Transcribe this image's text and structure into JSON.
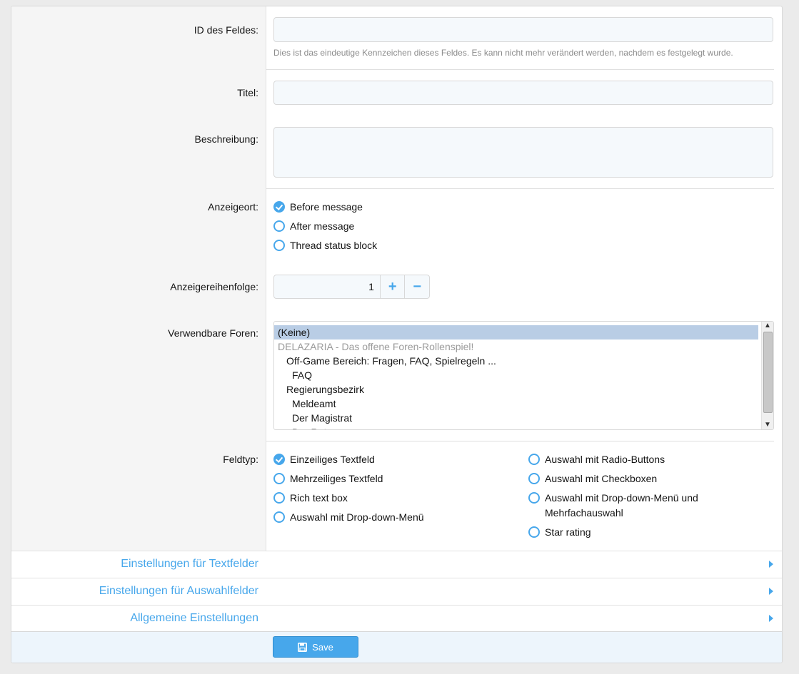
{
  "fields": {
    "field_id": {
      "label": "ID des Feldes:",
      "value": "",
      "hint": "Dies ist das eindeutige Kennzeichen dieses Feldes. Es kann nicht mehr verändert werden, nachdem es festgelegt wurde."
    },
    "title": {
      "label": "Titel:",
      "value": ""
    },
    "description": {
      "label": "Beschreibung:",
      "value": ""
    }
  },
  "display_location": {
    "label": "Anzeigeort:",
    "options": [
      {
        "label": "Before message",
        "checked": true
      },
      {
        "label": "After message",
        "checked": false
      },
      {
        "label": "Thread status block",
        "checked": false
      }
    ]
  },
  "display_order": {
    "label": "Anzeigereihenfolge:",
    "value": "1",
    "plus": "+",
    "minus": "−"
  },
  "forums": {
    "label": "Verwendbare Foren:",
    "options": [
      {
        "label": "(Keine)",
        "selected": true,
        "disabled": false,
        "depth": 0
      },
      {
        "label": "DELAZARIA - Das offene Foren-Rollenspiel!",
        "selected": false,
        "disabled": true,
        "depth": 0
      },
      {
        "label": "Off-Game Bereich: Fragen, FAQ, Spielregeln ...",
        "selected": false,
        "disabled": false,
        "depth": 1
      },
      {
        "label": "FAQ",
        "selected": false,
        "disabled": false,
        "depth": 2
      },
      {
        "label": "Regierungsbezirk",
        "selected": false,
        "disabled": false,
        "depth": 1
      },
      {
        "label": "Meldeamt",
        "selected": false,
        "disabled": false,
        "depth": 2
      },
      {
        "label": "Der Magistrat",
        "selected": false,
        "disabled": false,
        "depth": 2
      },
      {
        "label": "Der Rat",
        "selected": false,
        "disabled": false,
        "depth": 2
      }
    ]
  },
  "field_type": {
    "label": "Feldtyp:",
    "left": [
      {
        "label": "Einzeiliges Textfeld",
        "checked": true
      },
      {
        "label": "Mehrzeiliges Textfeld",
        "checked": false
      },
      {
        "label": "Rich text box",
        "checked": false
      },
      {
        "label": "Auswahl mit Drop-down-Menü",
        "checked": false
      }
    ],
    "right": [
      {
        "label": "Auswahl mit Radio-Buttons",
        "checked": false
      },
      {
        "label": "Auswahl mit Checkboxen",
        "checked": false
      },
      {
        "label": "Auswahl mit Drop-down-Menü und",
        "label2": "Mehrfachauswahl",
        "checked": false
      },
      {
        "label": "Star rating",
        "checked": false
      }
    ]
  },
  "sections": [
    "Einstellungen für Textfelder",
    "Einstellungen für Auswahlfelder",
    "Allgemeine Einstellungen"
  ],
  "save_button": {
    "label": "Save",
    "icon": "save-icon"
  },
  "colors": {
    "accent": "#47a7eb",
    "label_bg": "#f5f5f5",
    "footer_bg": "#edf5fc"
  }
}
